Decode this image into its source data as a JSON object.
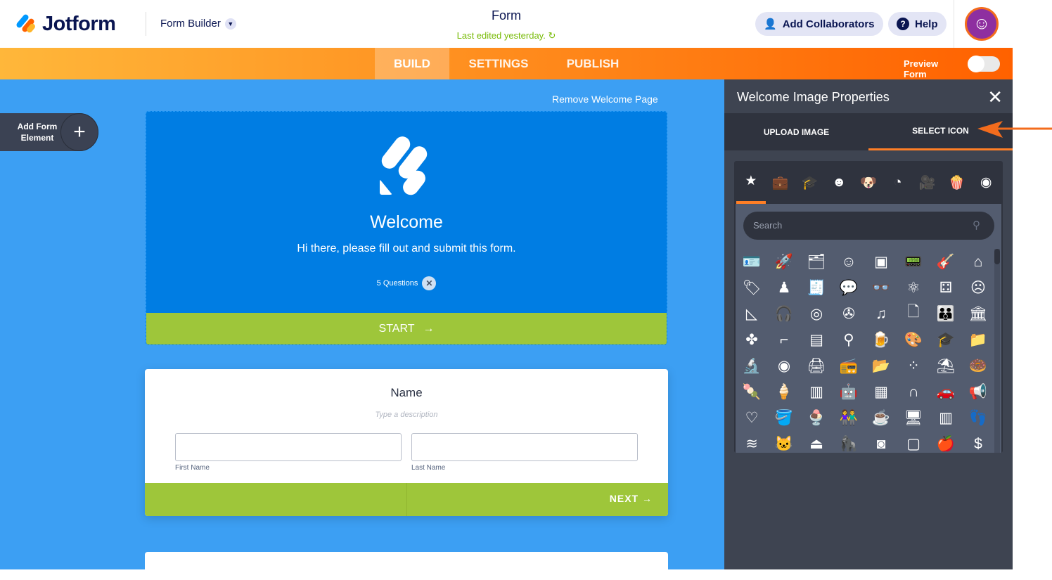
{
  "header": {
    "brand": "Jotform",
    "builder_label": "Form Builder",
    "form_title": "Form",
    "last_edited": "Last edited yesterday.",
    "add_collaborators": "Add Collaborators",
    "help": "Help"
  },
  "nav": {
    "tabs": [
      "BUILD",
      "SETTINGS",
      "PUBLISH"
    ],
    "active": "BUILD",
    "preview_form": "Preview Form",
    "preview_on": false
  },
  "canvas": {
    "remove_welcome": "Remove Welcome Page",
    "add_element": "Add Form Element",
    "welcome": {
      "title": "Welcome",
      "subtitle": "Hi there, please fill out and submit this form.",
      "questions": "5 Questions",
      "start": "START"
    },
    "name_card": {
      "title": "Name",
      "description_placeholder": "Type a description",
      "first_label": "First Name",
      "last_label": "Last Name",
      "next": "NEXT"
    }
  },
  "panel": {
    "title": "Welcome Image Properties",
    "tabs": [
      "UPLOAD IMAGE",
      "SELECT ICON"
    ],
    "active_tab": "SELECT ICON",
    "search_placeholder": "Search",
    "categories": [
      "star",
      "briefcase",
      "graduation-cap",
      "smiley",
      "dog",
      "pacman",
      "video-camera",
      "popcorn",
      "eye"
    ],
    "icons": [
      "id-badge",
      "rocket",
      "folders",
      "smile",
      "id-card",
      "walkie-talkie",
      "guitar",
      "hanger",
      "tag",
      "astronaut",
      "receipt",
      "speech-bubble",
      "glasses",
      "atom",
      "domino",
      "devil",
      "sail",
      "headphones",
      "vinyl",
      "film-reel",
      "music-note",
      "font-file",
      "family",
      "bank",
      "fidget-spinner",
      "boomerang",
      "sim-card",
      "rattle",
      "beer-mug",
      "palette",
      "graduation-cap",
      "folder",
      "microscope",
      "ring",
      "printer",
      "amplifier",
      "folder-upload",
      "necklace",
      "lamp",
      "donut",
      "popsicle",
      "ice-pop",
      "sim-card-outline",
      "robot",
      "browser",
      "jump-rope",
      "car",
      "megaphone",
      "hearts",
      "bucket",
      "ice-cream",
      "twins",
      "mug",
      "computer",
      "barcode-receipt",
      "footprint",
      "waves",
      "cat",
      "kettlebell",
      "gorilla",
      "safe",
      "frame",
      "apple",
      "dollar-sign"
    ]
  },
  "colors": {
    "orange": "#ff6100",
    "canvas": "#3c9ff3",
    "welcome": "#007de3",
    "green": "#9ec63a",
    "panel": "#3e4451"
  }
}
